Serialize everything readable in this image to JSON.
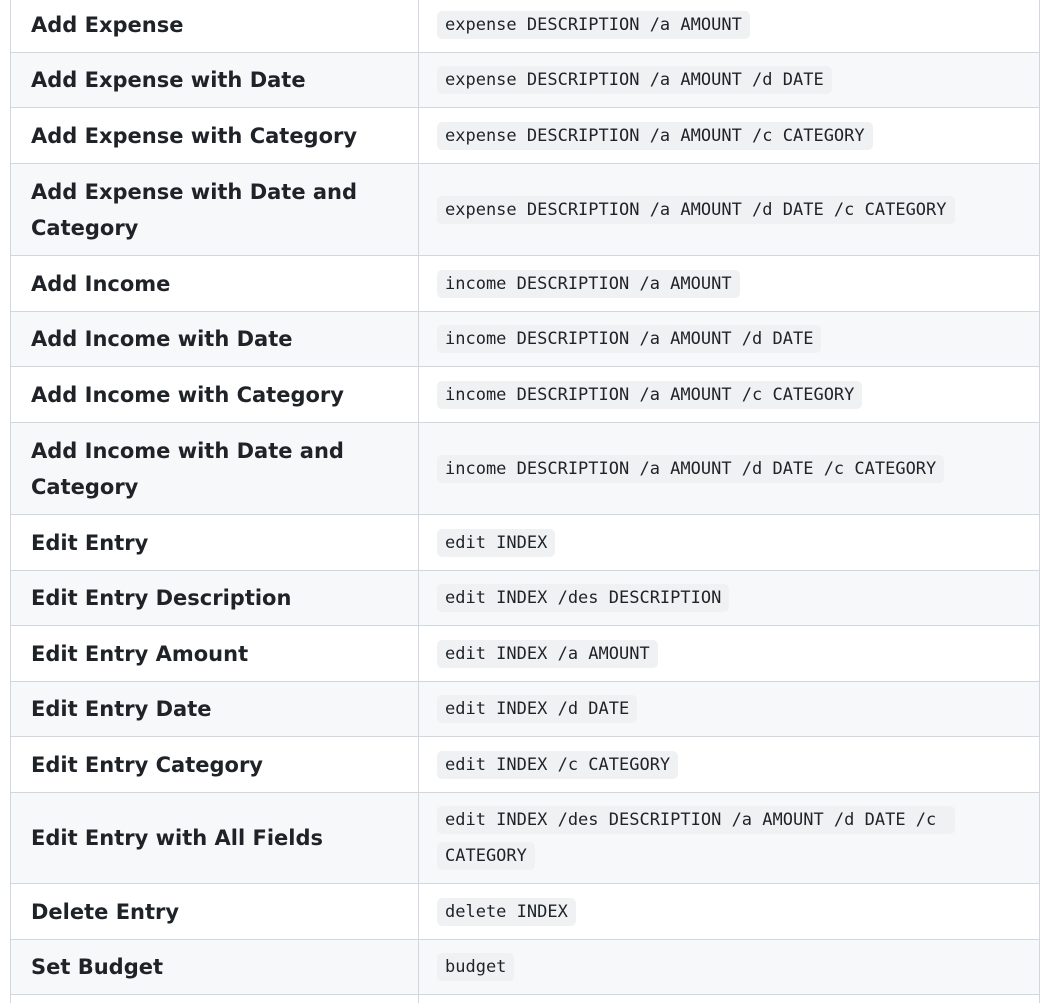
{
  "rows": [
    {
      "label": "Add Expense",
      "command": "expense DESCRIPTION /a AMOUNT"
    },
    {
      "label": "Add Expense with Date",
      "command": "expense DESCRIPTION /a AMOUNT /d DATE"
    },
    {
      "label": "Add Expense with Category",
      "command": "expense DESCRIPTION /a AMOUNT /c CATEGORY"
    },
    {
      "label": "Add Expense with Date and Category",
      "command": "expense DESCRIPTION /a AMOUNT /d DATE /c CATEGORY"
    },
    {
      "label": "Add Income",
      "command": "income DESCRIPTION /a AMOUNT"
    },
    {
      "label": "Add Income with Date",
      "command": "income DESCRIPTION /a AMOUNT /d DATE"
    },
    {
      "label": "Add Income with Category",
      "command": "income DESCRIPTION /a AMOUNT /c CATEGORY"
    },
    {
      "label": "Add Income with Date and Category",
      "command": "income DESCRIPTION /a AMOUNT /d DATE /c CATEGORY"
    },
    {
      "label": "Edit Entry",
      "command": "edit INDEX"
    },
    {
      "label": "Edit Entry Description",
      "command": "edit INDEX /des DESCRIPTION"
    },
    {
      "label": "Edit Entry Amount",
      "command": "edit INDEX /a AMOUNT"
    },
    {
      "label": "Edit Entry Date",
      "command": "edit INDEX /d DATE"
    },
    {
      "label": "Edit Entry Category",
      "command": "edit INDEX /c CATEGORY"
    },
    {
      "label": "Edit Entry with All Fields",
      "command": "edit INDEX /des DESCRIPTION /a AMOUNT /d DATE /c CATEGORY"
    },
    {
      "label": "Delete Entry",
      "command": "delete INDEX"
    },
    {
      "label": "Set Budget",
      "command": "budget"
    },
    {
      "label": "",
      "command": ""
    }
  ]
}
